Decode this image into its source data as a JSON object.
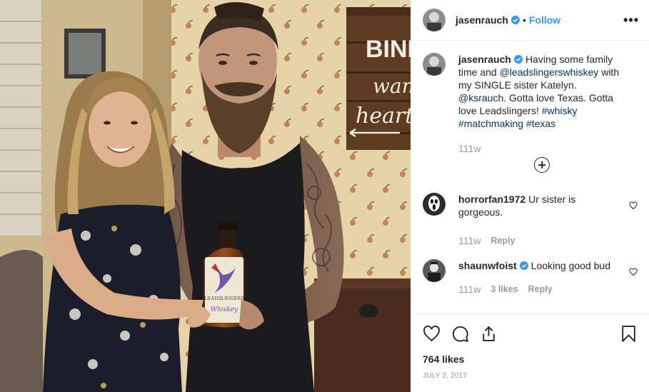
{
  "post": {
    "author": "jasenrauch",
    "follow_label": "Follow",
    "separator": "•",
    "more_label": "•••",
    "caption": {
      "text_1": "Having some family time and ",
      "mention_1": "@leadslingerswhiskey",
      "text_2": " with my SINGLE sister Katelyn. ",
      "mention_2": "@ksrauch",
      "text_3": ". Gotta love Texas. Gotta love Leadslingers! ",
      "hashtags": [
        "#whisky",
        "#matchmaking",
        "#texas"
      ],
      "time": "111w"
    },
    "photo_text": {
      "sign_line_1": "BIND",
      "sign_line_2": "wan",
      "sign_line_3": "heart",
      "bottle_brand": "LEADSLINGERS",
      "bottle_sub": "Whiskey"
    },
    "comments": [
      {
        "user": "horrorfan1972",
        "text": "Ur sister is gorgeous.",
        "time": "111w",
        "likes": "",
        "reply": "Reply"
      },
      {
        "user": "shaunwfoist",
        "verified": true,
        "text": "Looking good bud",
        "time": "111w",
        "likes": "3 likes",
        "reply": "Reply"
      }
    ],
    "likes": "764 likes",
    "date": "JULY 2, 2017"
  },
  "colors": {
    "link": "#003569",
    "follow": "#3897f0",
    "muted": "#999999",
    "border": "#efefef"
  },
  "icons": [
    "verified-badge-icon",
    "more-options-icon",
    "load-more-icon",
    "heart-icon",
    "comment-icon",
    "share-icon",
    "bookmark-icon"
  ]
}
